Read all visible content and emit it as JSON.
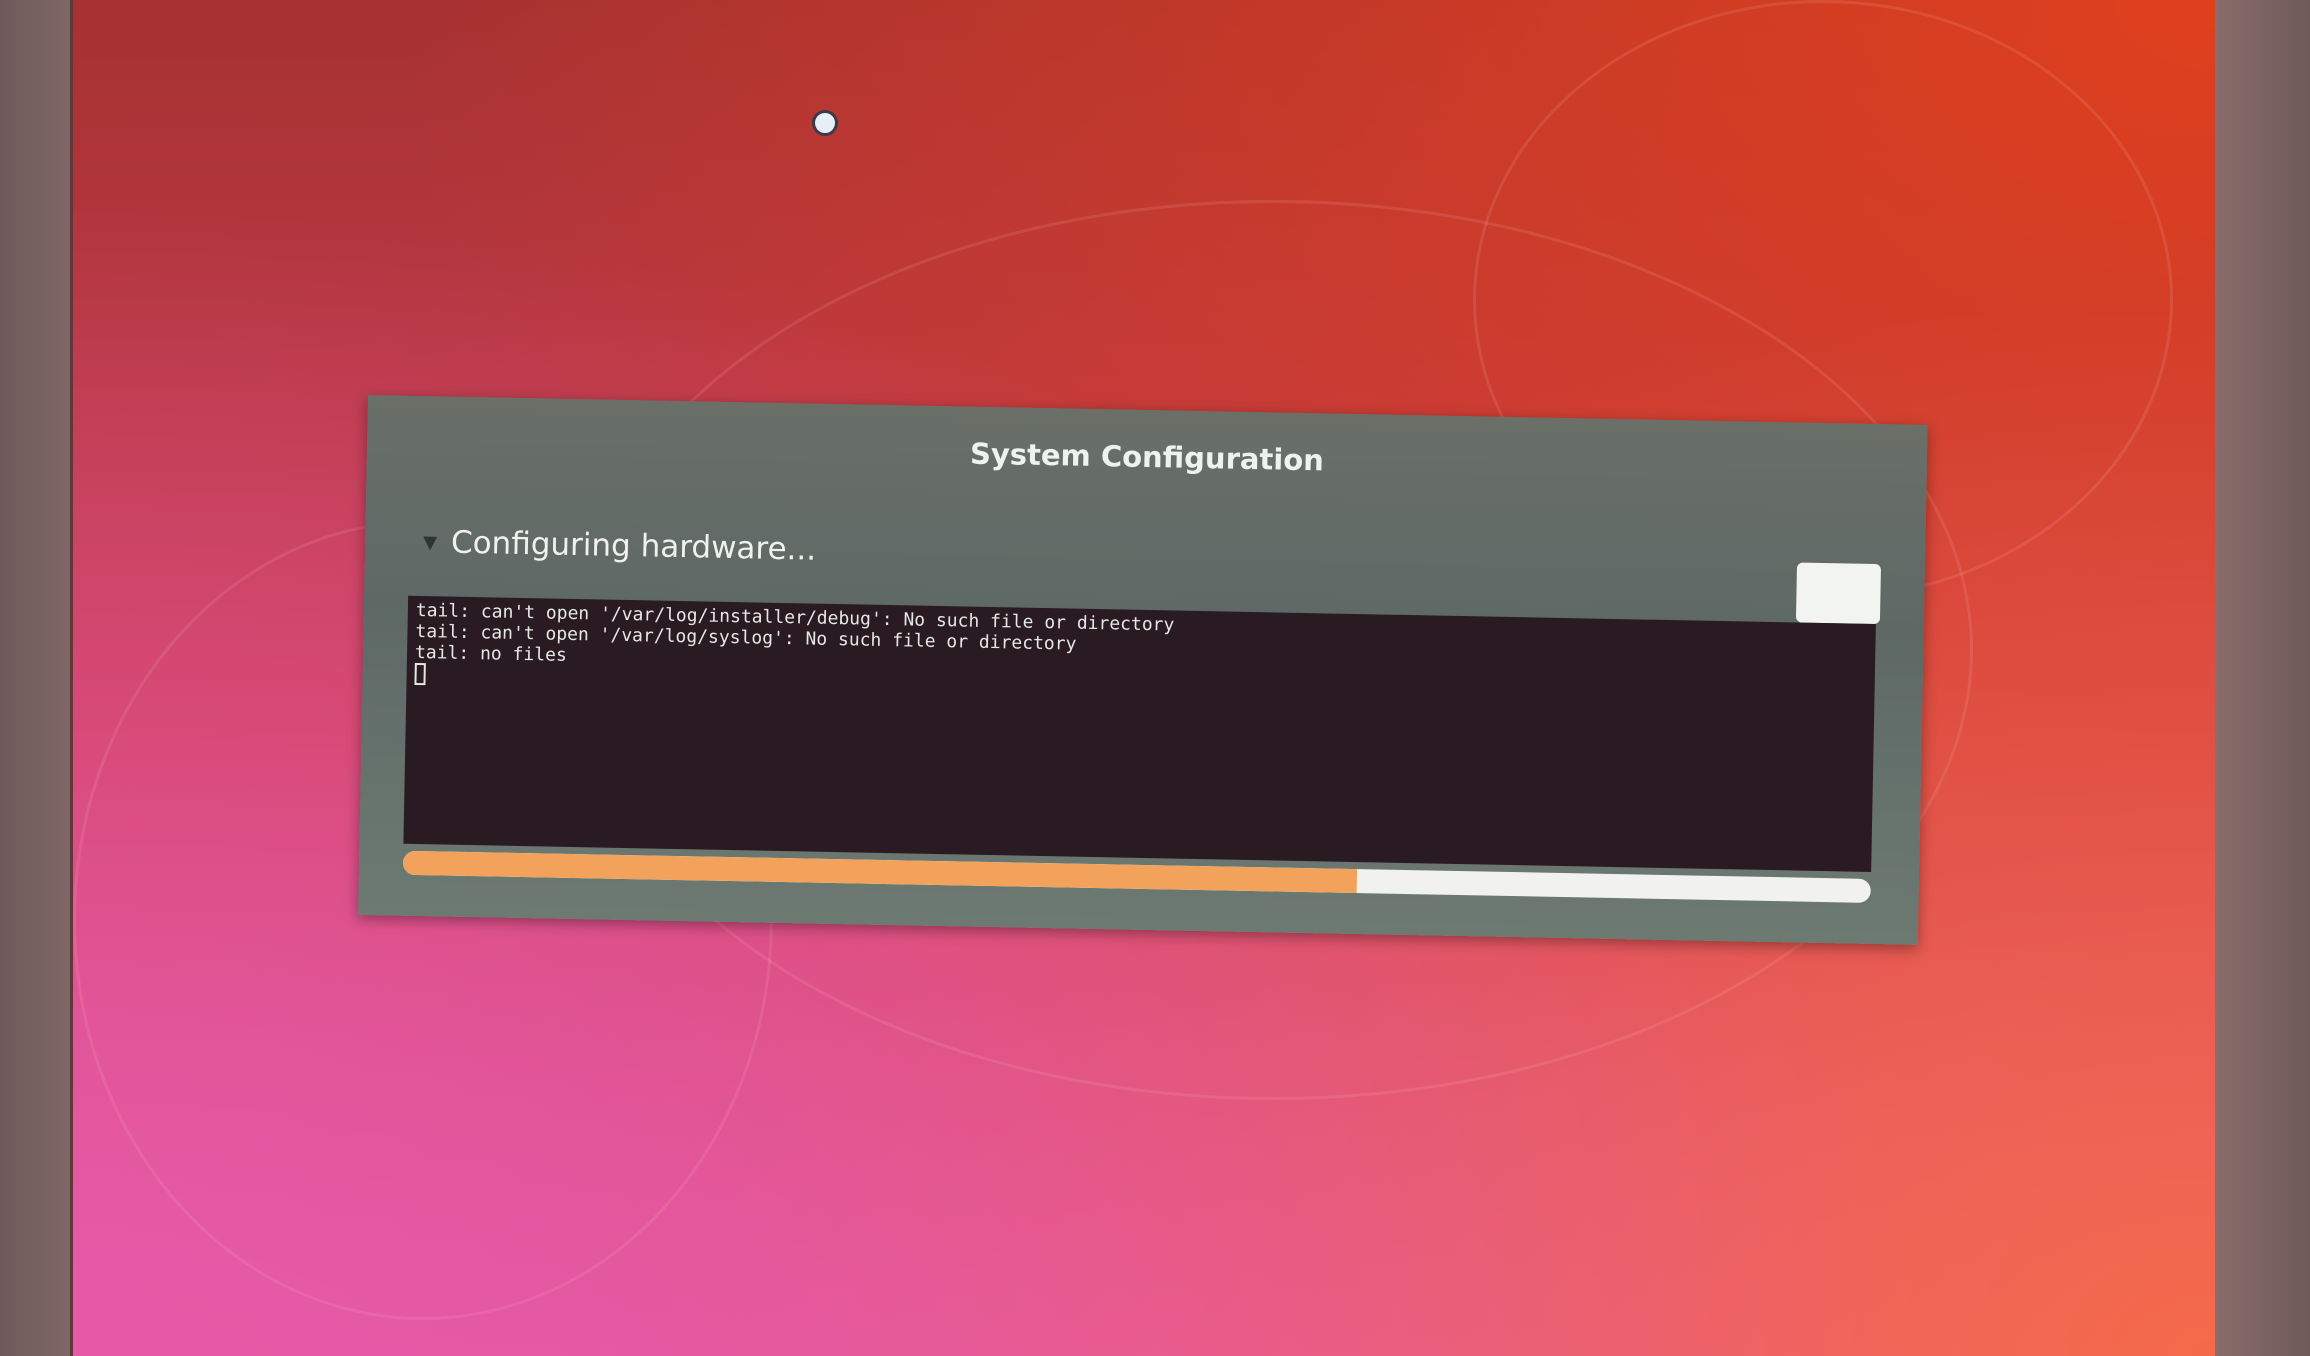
{
  "dialog": {
    "title": "System Configuration",
    "status": "Configuring hardware...",
    "terminal_lines": [
      "tail: can't open '/var/log/installer/debug': No such file or directory",
      "tail: can't open '/var/log/syslog': No such file or directory",
      "tail: no files"
    ],
    "progress_percent": 65
  },
  "colors": {
    "progress_fill": "#f2a25a",
    "terminal_bg": "#2a1a22",
    "dialog_bg": "#5e6966"
  }
}
